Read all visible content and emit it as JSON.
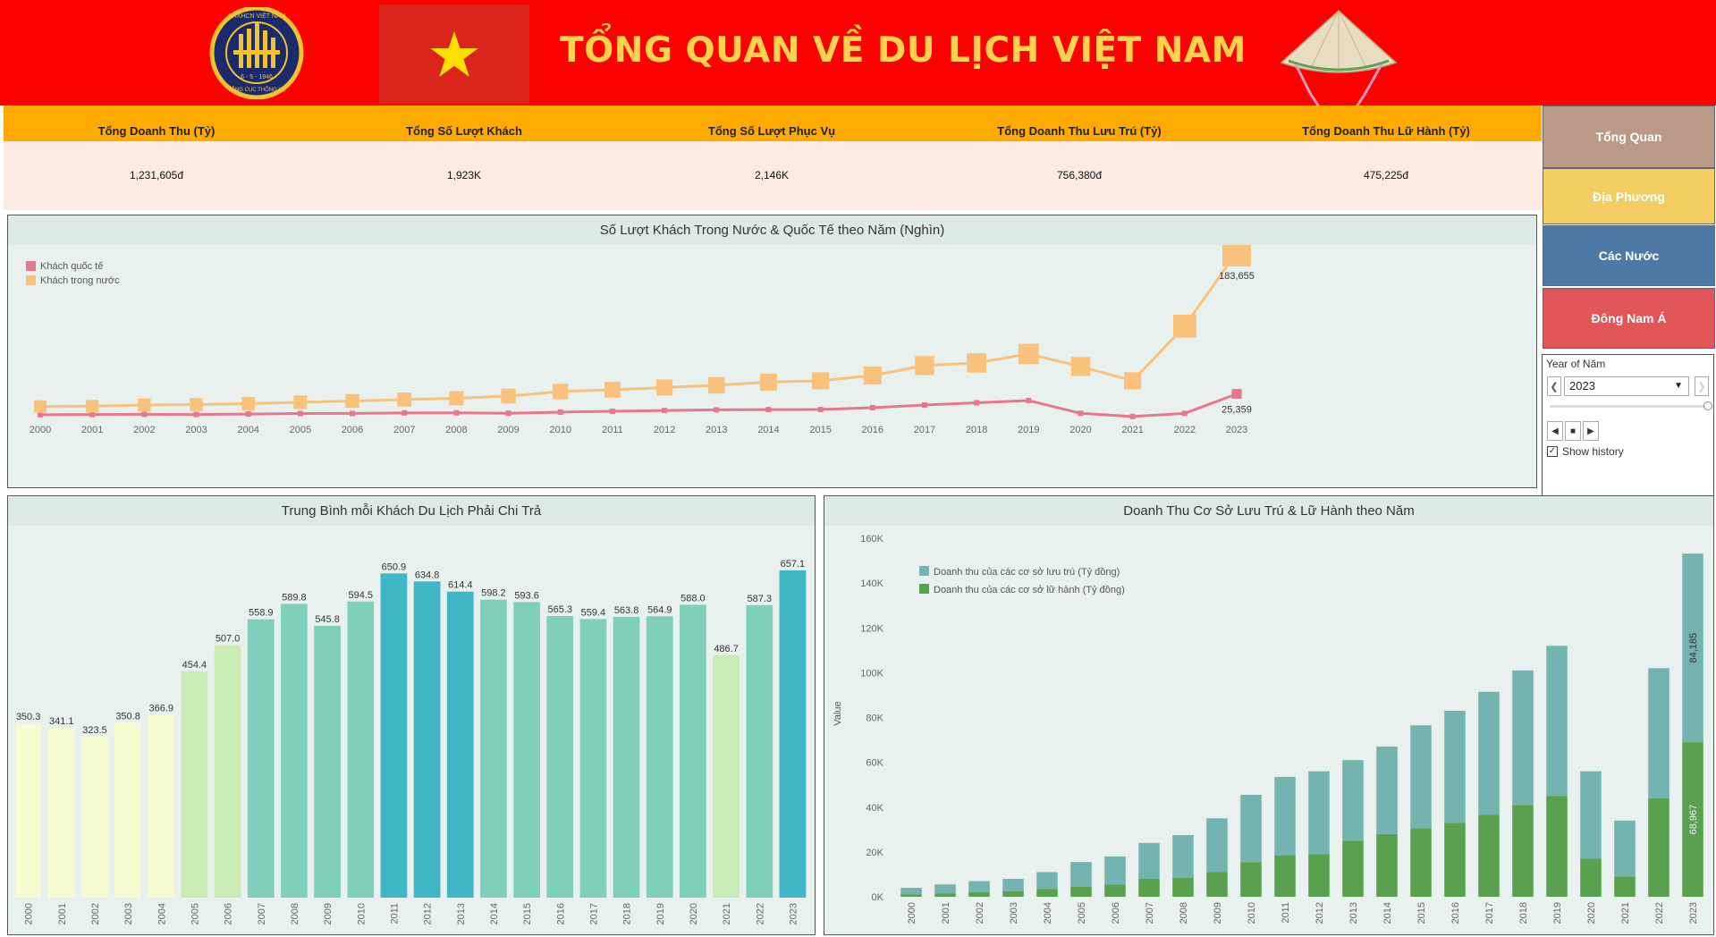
{
  "header": {
    "title": "TỔNG QUAN VỀ DU LỊCH VIỆT NAM",
    "logo_top": "CHXHCN VIỆT NAM",
    "logo_date": "6 - 5 - 1946",
    "logo_bottom": "TỔNG CỤC THỐNG KÊ",
    "colors": {
      "banner": "#fb0202",
      "title": "#ffd24d",
      "flag": "#da251d",
      "star": "#ffde00"
    }
  },
  "kpis": [
    {
      "label": "Tổng Doanh Thu (Tỷ)",
      "value": "1,231,605đ"
    },
    {
      "label": "Tổng Số Lượt Khách",
      "value": "1,923K"
    },
    {
      "label": "Tổng Số Lượt Phục Vụ",
      "value": "2,146K"
    },
    {
      "label": "Tổng Doanh Thu Lưu Trú (Tỷ)",
      "value": "756,380đ"
    },
    {
      "label": "Tổng Doanh Thu Lữ Hành (Tỷ)",
      "value": "475,225đ"
    }
  ],
  "nav": [
    {
      "label": "Tổng Quan",
      "color": "#b99a88"
    },
    {
      "label": "Địa Phương",
      "color": "#f1cd62"
    },
    {
      "label": "Các Nước",
      "color": "#4e79a7"
    },
    {
      "label": "Đông Nam Á",
      "color": "#e15759"
    }
  ],
  "filter": {
    "label": "Year of Năm",
    "selected": "2023",
    "show_history": "Show history"
  },
  "chart_data": [
    {
      "type": "line",
      "title": "Số Lượt Khách Trong Nước & Quốc Tế theo Năm (Nghìn)",
      "x": [
        "2000",
        "2001",
        "2002",
        "2003",
        "2004",
        "2005",
        "2006",
        "2007",
        "2008",
        "2009",
        "2010",
        "2011",
        "2012",
        "2013",
        "2014",
        "2015",
        "2016",
        "2017",
        "2018",
        "2019",
        "2020",
        "2021",
        "2022",
        "2023"
      ],
      "series": [
        {
          "name": "Khách quốc tế",
          "color": "#e8768d",
          "values": [
            2140,
            2330,
            2630,
            2430,
            2930,
            3480,
            3580,
            4170,
            4250,
            3770,
            5050,
            6010,
            6850,
            7570,
            7870,
            7940,
            10010,
            12920,
            15500,
            18000,
            3690,
            160,
            3660,
            25359
          ]
        },
        {
          "name": "Khách trong nước",
          "color": "#f8c27d",
          "values": [
            11200,
            11700,
            13000,
            13500,
            14500,
            16100,
            17500,
            19100,
            20500,
            23000,
            28000,
            30000,
            32500,
            35000,
            38500,
            40000,
            46000,
            57000,
            60000,
            70000,
            56000,
            40000,
            101000,
            183655
          ]
        }
      ],
      "labels": {
        "end_domestic": "183,655",
        "end_international": "25,359"
      },
      "legend": "top-left",
      "grid": false
    },
    {
      "type": "bar",
      "title": "Trung Bình mỗi Khách Du Lịch Phải Chi Trả",
      "categories": [
        "2000",
        "2001",
        "2002",
        "2003",
        "2004",
        "2005",
        "2006",
        "2007",
        "2008",
        "2009",
        "2010",
        "2011",
        "2012",
        "2013",
        "2014",
        "2015",
        "2016",
        "2017",
        "2018",
        "2019",
        "2020",
        "2021",
        "2022",
        "2023"
      ],
      "values": [
        350.3,
        341.1,
        323.5,
        350.8,
        366.9,
        454.4,
        507.0,
        558.9,
        589.8,
        545.8,
        594.5,
        650.9,
        634.8,
        614.4,
        598.2,
        593.6,
        565.3,
        559.4,
        563.8,
        564.9,
        588.0,
        486.7,
        587.3,
        657.1
      ],
      "value_labels": [
        "350.3",
        "341.1",
        "323.5",
        "350.8",
        "366.9",
        "454.4",
        "507.0",
        "558.9",
        "589.8",
        "545.8",
        "594.5",
        "650.9",
        "634.8",
        "614.4",
        "598.2",
        "593.6",
        "565.3",
        "559.4",
        "563.8",
        "564.9",
        "588.0",
        "486.7",
        "587.3",
        "657.1"
      ],
      "color_scale": [
        "#f6fbd2",
        "#c9ebb4",
        "#7fd0bb",
        "#41b6c4"
      ]
    },
    {
      "type": "bar",
      "stacked": true,
      "title": "Doanh Thu Cơ Sở Lưu Trú & Lữ Hành theo Năm",
      "ylabel": "Value",
      "ylim": [
        0,
        160000
      ],
      "yticks": [
        "0K",
        "20K",
        "40K",
        "60K",
        "80K",
        "100K",
        "120K",
        "140K",
        "160K"
      ],
      "categories": [
        "2000",
        "2001",
        "2002",
        "2003",
        "2004",
        "2005",
        "2006",
        "2007",
        "2008",
        "2009",
        "2010",
        "2011",
        "2012",
        "2013",
        "2014",
        "2015",
        "2016",
        "2017",
        "2018",
        "2019",
        "2020",
        "2021",
        "2022",
        "2023"
      ],
      "series": [
        {
          "name": "Doanh thu của các cơ sở lưu trú (Tỷ đồng)",
          "color": "#73b3b0",
          "values": [
            3000,
            4000,
            5000,
            5500,
            7500,
            11000,
            12500,
            16000,
            19000,
            24000,
            30000,
            35000,
            37000,
            36000,
            39000,
            46000,
            50000,
            55000,
            60000,
            67000,
            39000,
            25000,
            58000,
            84185
          ]
        },
        {
          "name": "Doanh thu của các cơ sở lữ hành (Tỷ đồng)",
          "color": "#59a14f",
          "values": [
            1000,
            1500,
            2000,
            2500,
            3500,
            4500,
            5500,
            8000,
            8500,
            11000,
            15500,
            18500,
            19000,
            25000,
            28000,
            30500,
            33000,
            36500,
            41000,
            45000,
            17000,
            9000,
            44000,
            68967
          ]
        }
      ],
      "value_labels": {
        "lodging_2023": "84,185",
        "travel_2023": "68,967"
      },
      "legend": "top-left"
    }
  ]
}
